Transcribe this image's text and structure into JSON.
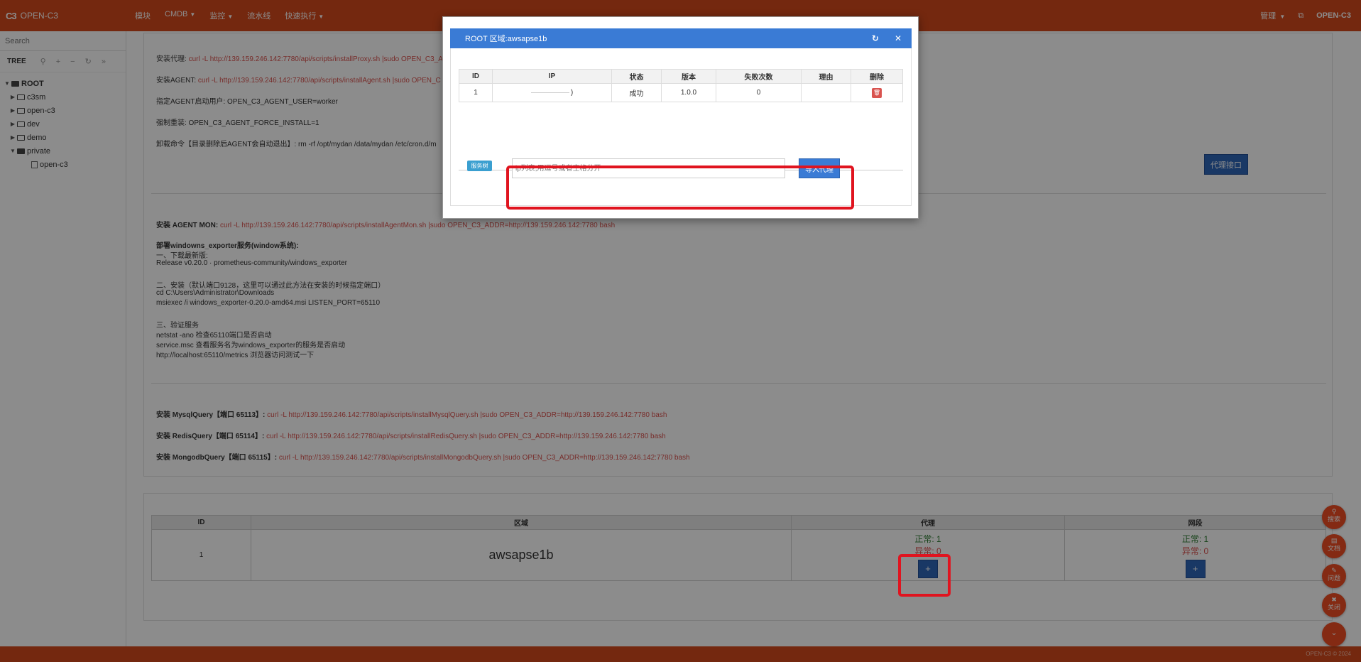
{
  "topbar": {
    "logo": "C3",
    "brand": "OPEN-C3",
    "nav": [
      "模块",
      "CMDB",
      "监控",
      "流水线",
      "快速执行"
    ],
    "nav_dropdown": [
      false,
      true,
      true,
      false,
      true
    ],
    "manage": "管理",
    "user": "OPEN-C3"
  },
  "sidebar": {
    "search_placeholder": "Search",
    "tree_label": "TREE",
    "toolbar_icons": [
      "pin-icon",
      "plus-icon",
      "minus-icon",
      "refresh-icon",
      "forward-icon"
    ],
    "nodes": [
      {
        "label": "ROOT",
        "level": 0,
        "expanded": true,
        "type": "folder-open",
        "bold": true
      },
      {
        "label": "c3sm",
        "level": 1,
        "expanded": false,
        "type": "folder"
      },
      {
        "label": "open-c3",
        "level": 1,
        "expanded": false,
        "type": "folder"
      },
      {
        "label": "dev",
        "level": 1,
        "expanded": false,
        "type": "folder"
      },
      {
        "label": "demo",
        "level": 1,
        "expanded": false,
        "type": "folder"
      },
      {
        "label": "private",
        "level": 1,
        "expanded": true,
        "type": "folder-open"
      },
      {
        "label": "open-c3",
        "level": 2,
        "expanded": false,
        "type": "file"
      }
    ]
  },
  "instructions": {
    "install_proxy_label": "安装代理:",
    "install_proxy_cmd": "curl -L http://139.159.246.142:7780/api/scripts/installProxy.sh |sudo OPEN_C3_A",
    "install_agent_label": "安装AGENT:",
    "install_agent_cmd": "curl -L http://139.159.246.142:7780/api/scripts/installAgent.sh |sudo OPEN_C",
    "agent_user": "指定AGENT启动用户: OPEN_C3_AGENT_USER=worker",
    "force_install": "强制重装: OPEN_C3_AGENT_FORCE_INSTALL=1",
    "uninstall": "卸载命令【目录删除后AGENT会自动退出】: rm -rf /opt/mydan /data/mydan /etc/cron.d/m",
    "proxy_api_btn": "代理接口",
    "agent_mon_label": "安装 AGENT MON:",
    "agent_mon_cmd": "curl -L http://139.159.246.142:7780/api/scripts/installAgentMon.sh |sudo OPEN_C3_ADDR=http://139.159.246.142:7780 bash",
    "win_title": "部署windowns_exporter服务(window系统):",
    "win_lines": [
      "一、下载最新版:",
      "Release v0.20.0 · prometheus-community/windows_exporter",
      "",
      "二、安装（默认端口9128，这里可以通过此方法在安装的时候指定端口）",
      "cd C:\\Users\\Administrator\\Downloads",
      "msiexec /i windows_exporter-0.20.0-amd64.msi LISTEN_PORT=65110",
      "",
      "三、验证服务",
      "netstat -ano 检查65110端口是否启动",
      "service.msc 查看服务名为windows_exporter的服务是否启动",
      "http://localhost:65110/metrics 浏览器访问测试一下"
    ],
    "mysql_label": "安装 MysqlQuery【端口 65113】:",
    "mysql_cmd": "curl -L http://139.159.246.142:7780/api/scripts/installMysqlQuery.sh |sudo OPEN_C3_ADDR=http://139.159.246.142:7780 bash",
    "redis_label": "安装 RedisQuery【端口 65114】:",
    "redis_cmd": "curl -L http://139.159.246.142:7780/api/scripts/installRedisQuery.sh |sudo OPEN_C3_ADDR=http://139.159.246.142:7780 bash",
    "mongo_label": "安装 MongodbQuery【端口 65115】:",
    "mongo_cmd": "curl -L http://139.159.246.142:7780/api/scripts/installMongodbQuery.sh |sudo OPEN_C3_ADDR=http://139.159.246.142:7780 bash"
  },
  "region_table": {
    "headers": [
      "ID",
      "区域",
      "代理",
      "网段"
    ],
    "rows": [
      {
        "id": "1",
        "region": "awsapse1b",
        "proxy_ok": "正常: 1",
        "proxy_err": "异常: 0",
        "net_ok": "正常: 1",
        "net_err": "异常: 0"
      }
    ]
  },
  "modal": {
    "title": "ROOT 区域:awsapse1b",
    "headers": [
      "ID",
      "IP",
      "状态",
      "版本",
      "失败次数",
      "理由",
      "删除"
    ],
    "rows": [
      {
        "id": "1",
        "ip": ")",
        "status": "成功",
        "version": "1.0.0",
        "fail_count": "0",
        "reason": ""
      }
    ],
    "service_tag": "服务树",
    "ip_placeholder": "ip列表,用逗号或者空格分开",
    "import_btn": "导入代理"
  },
  "fabs": [
    {
      "icon": "search-icon",
      "label": "搜索"
    },
    {
      "icon": "doc-icon",
      "label": "文档"
    },
    {
      "icon": "edit-icon",
      "label": "问题"
    },
    {
      "icon": "close-icon",
      "label": "关闭"
    },
    {
      "icon": "double-chevron-down-icon",
      "label": ""
    }
  ],
  "footer": "OPEN-C3 © 2024",
  "colors": {
    "topbar": "#d44a1c",
    "modal_header": "#3a7bd5",
    "highlight": "#e0141f",
    "fab": "#f04e23"
  }
}
